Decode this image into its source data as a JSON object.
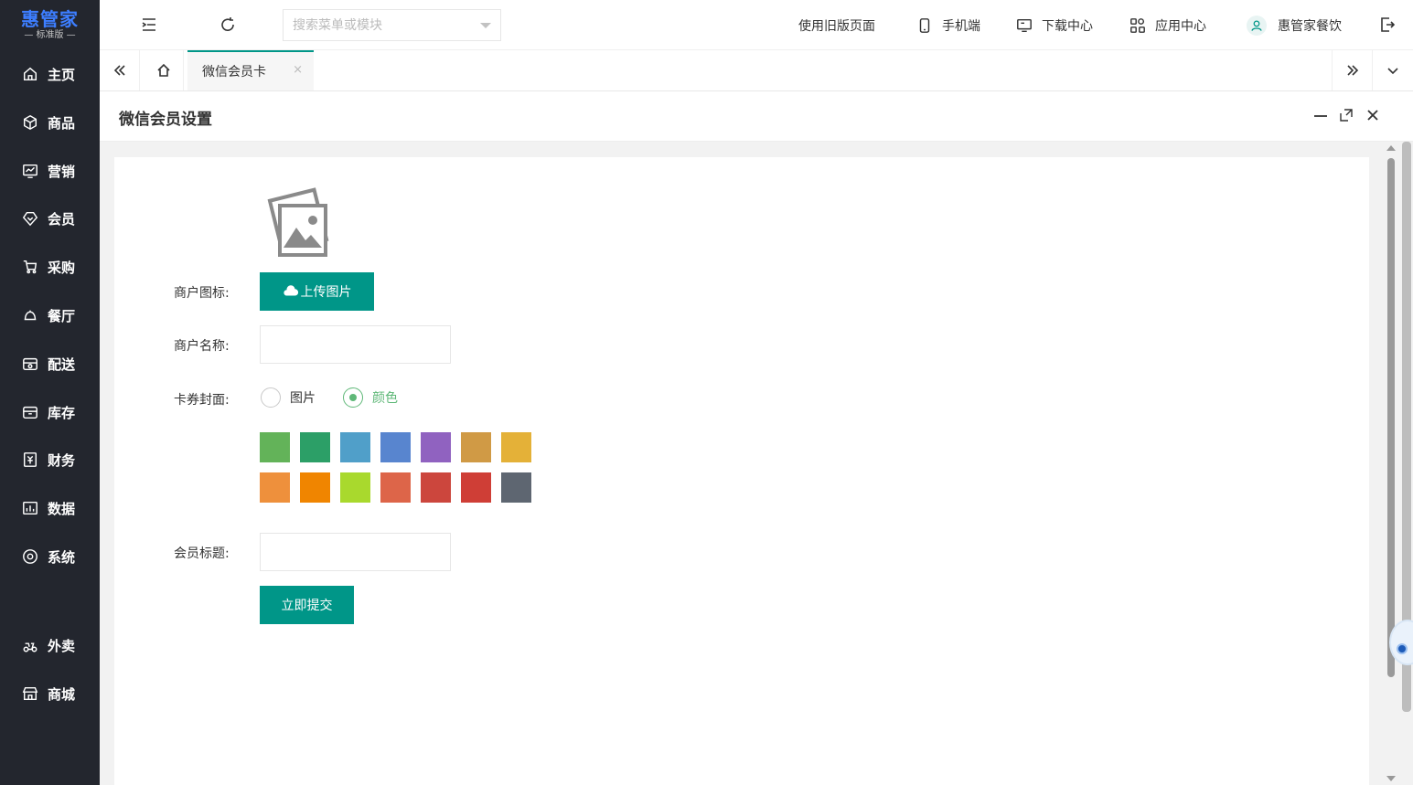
{
  "logo": {
    "main": "惠管家",
    "sub": "— 标准版 —"
  },
  "sidebar": {
    "items": [
      {
        "label": "主页",
        "icon": "home-icon"
      },
      {
        "label": "商品",
        "icon": "cube-icon"
      },
      {
        "label": "营销",
        "icon": "chart-icon"
      },
      {
        "label": "会员",
        "icon": "heart-shield-icon"
      },
      {
        "label": "采购",
        "icon": "cart-icon"
      },
      {
        "label": "餐厅",
        "icon": "bell-icon"
      },
      {
        "label": "配送",
        "icon": "store-icon"
      },
      {
        "label": "库存",
        "icon": "box-icon"
      },
      {
        "label": "财务",
        "icon": "yen-icon"
      },
      {
        "label": "数据",
        "icon": "bar-chart-icon"
      },
      {
        "label": "系统",
        "icon": "settings-circle-icon"
      },
      {
        "label": "外卖",
        "icon": "scooter-icon"
      },
      {
        "label": "商城",
        "icon": "shop-icon"
      }
    ]
  },
  "topbar": {
    "search_placeholder": "搜索菜单或模块",
    "old_version": "使用旧版页面",
    "mobile": "手机端",
    "download": "下载中心",
    "apps": "应用中心",
    "user": "惠管家餐饮"
  },
  "tabs": {
    "active": "微信会员卡",
    "close": "×"
  },
  "panel": {
    "title": "微信会员设置"
  },
  "form": {
    "merchant_icon_label": "商户图标:",
    "upload_label": "上传图片",
    "merchant_name_label": "商户名称:",
    "merchant_name_value": "",
    "cover_label": "卡券封面:",
    "cover_options": [
      "图片",
      "颜色"
    ],
    "cover_selected": "颜色",
    "colors": [
      "#63b359",
      "#2c9f67",
      "#509fc9",
      "#5885cf",
      "#9062c0",
      "#d09a45",
      "#e4b138",
      "#ee903c",
      "#f08500",
      "#a9d92d",
      "#dd6549",
      "#cc463d",
      "#cf3e36",
      "#5e6671"
    ],
    "member_title_label": "会员标题:",
    "member_title_value": "",
    "submit_label": "立即提交"
  }
}
